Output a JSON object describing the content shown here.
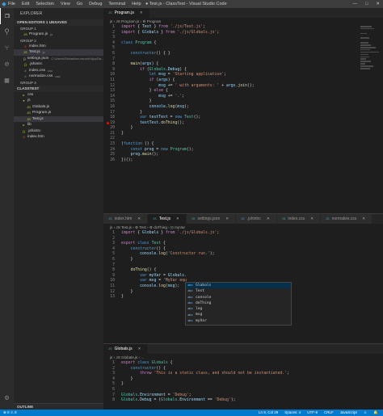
{
  "titlebar": {
    "menu": [
      "File",
      "Edit",
      "Selection",
      "View",
      "Go",
      "Debug",
      "Terminal",
      "Help"
    ],
    "title": "● Test.js - ClassTest - Visual Studio Code",
    "controls": [
      "—",
      "□",
      "✕"
    ]
  },
  "activity": {
    "icons": [
      "files-icon",
      "search-icon",
      "source-control-icon",
      "debug-icon",
      "extensions-icon"
    ]
  },
  "sidebar": {
    "header": "EXPLORER",
    "open_editors": "OPEN EDITORS  1 UNSAVED",
    "group1": "GROUP 1",
    "g1_items": [
      {
        "icon": "JS",
        "name": "Program.js",
        "dim": "js"
      }
    ],
    "group2": "GROUP 2",
    "g2_items": [
      {
        "icon": "5",
        "name": "index.htm",
        "dim": ""
      },
      {
        "icon": "JS",
        "name": "Test.js",
        "dim": "js",
        "sel": true
      },
      {
        "icon": "{}",
        "name": "settings.json",
        "dim": "C:\\Users\\Sebastian.vscode\\AppDa..."
      },
      {
        "icon": "{}",
        "name": ".jshintrc",
        "dim": ""
      },
      {
        "icon": "#",
        "name": "index.css",
        "dim": "css"
      },
      {
        "icon": "#",
        "name": "normalize.css",
        "dim": "css"
      }
    ],
    "group3": "GROUP 3",
    "classtest": "CLASSTEST",
    "tree": [
      {
        "icon": "▸",
        "name": "css",
        "indent": 1
      },
      {
        "icon": "▾",
        "name": "js",
        "indent": 1
      },
      {
        "icon": "JS",
        "name": "Globals.js",
        "indent": 2
      },
      {
        "icon": "JS",
        "name": "Program.js",
        "indent": 2
      },
      {
        "icon": "JS",
        "name": "Test.js",
        "indent": 2
      },
      {
        "icon": "▸",
        "name": "lib",
        "indent": 1
      },
      {
        "icon": "{}",
        "name": ".jshintrc",
        "indent": 1
      },
      {
        "icon": "5",
        "name": "index.htm",
        "indent": 1
      }
    ],
    "outline": "OUTLINE"
  },
  "editor1": {
    "tabs": [
      {
        "label": "Program.js",
        "active": true
      }
    ],
    "breadcrumb": "js › JS Program.js › ⚙ Program",
    "lines": [
      {
        "n": "1",
        "h": "<span class='c'>import</span> { <span class='v'>Test</span> } <span class='c'>from</span> <span class='s'>'./js/Test.js'</span>;"
      },
      {
        "n": "2",
        "h": "<span class='c'>import</span> { <span class='v'>Globals</span> } <span class='c'>from</span> <span class='s'>'./js/Globals.js'</span>;"
      },
      {
        "n": "3",
        "h": ""
      },
      {
        "n": "4",
        "h": "<span class='k'>class</span> <span class='t'>Program</span> {"
      },
      {
        "n": "5",
        "h": ""
      },
      {
        "n": "6",
        "h": "    <span class='k'>constructor</span>() { }"
      },
      {
        "n": "7",
        "h": ""
      },
      {
        "n": "8",
        "h": "    <span class='f'>main</span>(<span class='v'>args</span>) {"
      },
      {
        "n": "9",
        "h": "        <span class='c'>if</span> (<span class='t'>Globals</span>.<span class='v'>Debug</span>) {"
      },
      {
        "n": "10",
        "h": "            <span class='k'>let</span> <span class='v'>msg</span> = <span class='s'>'Starting application'</span>;"
      },
      {
        "n": "11",
        "h": "            <span class='c'>if</span> (<span class='v'>args</span>) {"
      },
      {
        "n": "12",
        "h": "                <span class='v'>msg</span> += <span class='s'>' with arguments: '</span> + <span class='v'>args</span>.<span class='f'>join</span>();"
      },
      {
        "n": "13",
        "h": "            } <span class='c'>else</span> {"
      },
      {
        "n": "14",
        "h": "                <span class='v'>msg</span> += <span class='s'>'.'</span>;"
      },
      {
        "n": "15",
        "h": "            }"
      },
      {
        "n": "16",
        "h": "            <span class='v'>console</span>.<span class='f'>log</span>(<span class='v'>msg</span>);"
      },
      {
        "n": "17",
        "h": "        }"
      },
      {
        "n": "18",
        "h": "        <span class='k'>var</span> <span class='v'>testTest</span> = <span class='k'>new</span> <span class='t'>Test</span>();"
      },
      {
        "n": "19",
        "h": "        <span class='v'>testTest</span>.<span class='f'>doThing</span>();"
      },
      {
        "n": "20",
        "h": "    }"
      },
      {
        "n": "21",
        "h": "}"
      },
      {
        "n": "22",
        "h": ""
      },
      {
        "n": "23",
        "h": "(<span class='k'>function</span> () {"
      },
      {
        "n": "24",
        "h": "    <span class='k'>const</span> <span class='v'>prog</span> = <span class='k'>new</span> <span class='t'>Program</span>();"
      },
      {
        "n": "25",
        "h": "    <span class='v'>prog</span>.<span class='f'>main</span>();"
      },
      {
        "n": "26",
        "h": "})();"
      }
    ]
  },
  "editor2": {
    "tabs": [
      {
        "label": "index.htm",
        "active": false
      },
      {
        "label": "Test.js",
        "active": true
      },
      {
        "label": "settings.json",
        "active": false
      },
      {
        "label": ".jshintrc",
        "active": false
      },
      {
        "label": "index.css",
        "active": false
      },
      {
        "label": "normalize.css",
        "active": false
      }
    ],
    "breadcrumb": "js › JS Test.js › ⚙ Test › ⚙ doThing › ⊡ myVar",
    "lines": [
      {
        "n": "1",
        "h": "<span class='c'>import</span> { <span class='v'>Globals</span> } <span class='c'>from</span> <span class='s'>'./js/Globals.js'</span>;"
      },
      {
        "n": "2",
        "h": ""
      },
      {
        "n": "3",
        "h": "<span class='c'>export</span> <span class='k'>class</span> <span class='t'>Test</span> {"
      },
      {
        "n": "4",
        "h": "    <span class='k'>constructor</span>() {"
      },
      {
        "n": "5",
        "h": "        <span class='v'>console</span>.<span class='f'>log</span>(<span class='s'>'Constructor run.'</span>);"
      },
      {
        "n": "6",
        "h": "    }"
      },
      {
        "n": "7",
        "h": ""
      },
      {
        "n": "8",
        "h": "    <span class='f'>doThing</span>() {"
      },
      {
        "n": "9",
        "h": "        <span class='k'>var</span> <span class='v'>myVar</span> = <span class='v'>Globals</span>."
      },
      {
        "n": "10",
        "h": "        <span class='k'>var</span> <span class='v'>msg</span> = <span class='s'>'MyVar equ</span>"
      },
      {
        "n": "11",
        "h": "        <span class='v'>console</span>.<span class='f'>log</span>(<span class='v'>msg</span>);"
      },
      {
        "n": "12",
        "h": "    }"
      },
      {
        "n": "13",
        "h": "}"
      }
    ],
    "suggest": [
      {
        "kind": "abc",
        "label": "Globals",
        "sel": true
      },
      {
        "kind": "abc",
        "label": "Test"
      },
      {
        "kind": "abc",
        "label": "console"
      },
      {
        "kind": "abc",
        "label": "doThing"
      },
      {
        "kind": "abc",
        "label": "log"
      },
      {
        "kind": "abc",
        "label": "msg"
      },
      {
        "kind": "abc",
        "label": "myVar"
      }
    ]
  },
  "editor3": {
    "tabs": [
      {
        "label": "Globals.js",
        "active": true
      }
    ],
    "breadcrumb": "js › JS Globals.js › ...",
    "lines": [
      {
        "n": "1",
        "h": "<span class='c'>export</span> <span class='k'>class</span> <span class='t'>Globals</span> {"
      },
      {
        "n": "2",
        "h": "    <span class='k'>constructor</span>() {"
      },
      {
        "n": "3",
        "h": "        <span class='c'>throw</span> <span class='s'>'This is a static class, and should not be instantiated.'</span>;"
      },
      {
        "n": "4",
        "h": "    }"
      },
      {
        "n": "5",
        "h": "}"
      },
      {
        "n": "6",
        "h": ""
      },
      {
        "n": "7",
        "h": "<span class='t'>Globals</span>.<span class='v'>Environment</span> = <span class='s'>'Debug'</span>;"
      },
      {
        "n": "8",
        "h": "<span class='t'>Globals</span>.<span class='v'>Debug</span> = (<span class='t'>Globals</span>.<span class='v'>Environment</span> == <span class='s'>'Debug'</span>);"
      }
    ]
  },
  "status": {
    "left": [
      "⊗ 0 ⚠ 0"
    ],
    "right": [
      "Ln 9, Col 29",
      "Spaces: 4",
      "UTF-8",
      "CRLF",
      "JavaScript",
      "☺",
      "🔔"
    ]
  }
}
